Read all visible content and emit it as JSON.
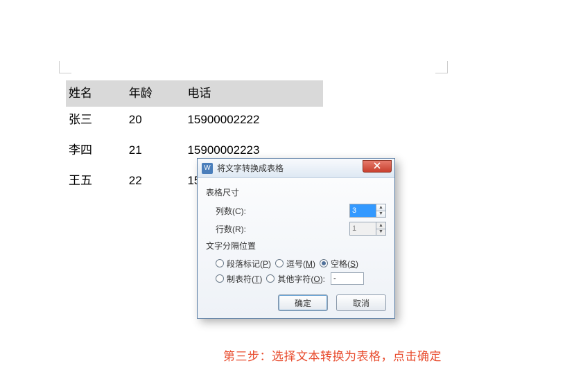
{
  "table": {
    "headers": {
      "name": "姓名",
      "age": "年龄",
      "phone": "电话"
    },
    "rows": [
      {
        "name": "张三",
        "age": "20",
        "phone": "15900002222"
      },
      {
        "name": "李四",
        "age": "21",
        "phone": "15900002223"
      },
      {
        "name": "王五",
        "age": "22",
        "phone_visible": "15"
      }
    ]
  },
  "dialog": {
    "app_glyph": "W",
    "title": "将文字转换成表格",
    "group_size": "表格尺寸",
    "cols_label": "列数(C):",
    "cols_value": "3",
    "rows_label": "行数(R):",
    "rows_value": "1",
    "group_sep": "文字分隔位置",
    "radios": {
      "para": {
        "text": "段落标记(",
        "hk": "P",
        "tail": ")"
      },
      "comma": {
        "text": "逗号(",
        "hk": "M",
        "tail": ")"
      },
      "space": {
        "text": "空格(",
        "hk": "S",
        "tail": ")"
      },
      "tab": {
        "text": "制表符(",
        "hk": "T",
        "tail": ")"
      },
      "other": {
        "text": "其他字符(",
        "hk": "O",
        "tail": "):"
      }
    },
    "other_value": "-",
    "ok": "确定",
    "cancel": "取消"
  },
  "caption": "第三步：选择文本转换为表格，点击确定"
}
